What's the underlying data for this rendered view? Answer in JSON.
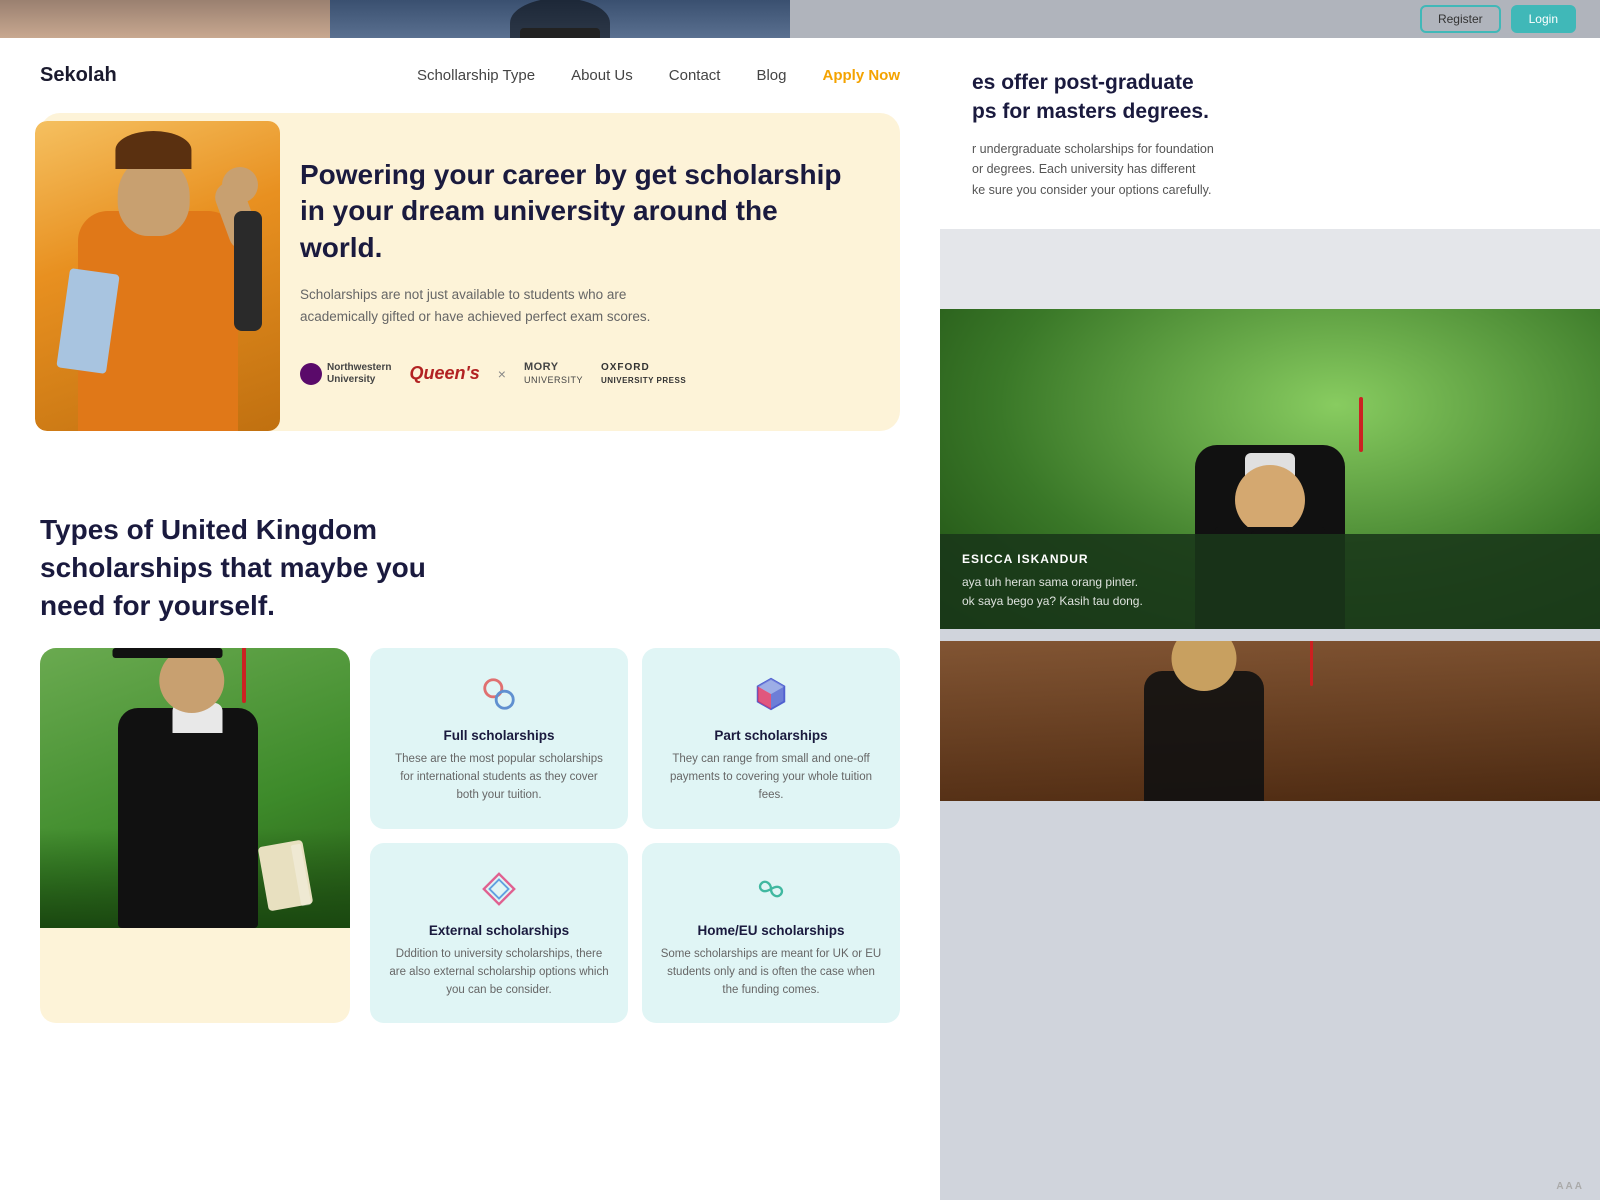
{
  "topBar": {
    "btn1": "Register",
    "btn2": "Login"
  },
  "navbar": {
    "logo": "Sekolah",
    "links": [
      {
        "label": "Schollarship Type",
        "active": false
      },
      {
        "label": "About Us",
        "active": false
      },
      {
        "label": "Contact",
        "active": false
      },
      {
        "label": "Blog",
        "active": false
      },
      {
        "label": "Apply Now",
        "active": true
      }
    ]
  },
  "hero": {
    "title": "Powering your career by get scholarship in your dream university around the world.",
    "subtitle": "Scholarships are not just available to students who are academically gifted or have achieved perfect exam scores.",
    "universities": [
      {
        "name": "Northwestern University",
        "type": "logo-text"
      },
      {
        "name": "Queens",
        "type": "stylized"
      },
      {
        "name": "×",
        "type": "separator"
      },
      {
        "name": "MORY UNIVERSITY",
        "type": "text"
      },
      {
        "name": "OXFORD UNIVERSITY PRESS",
        "type": "text"
      }
    ]
  },
  "section": {
    "heading": "Types of United Kingdom scholarships that maybe you need for yourself."
  },
  "scholarshipCards": [
    {
      "id": "full",
      "title": "Full scholarships",
      "description": "These are the most popular scholarships for international students as they cover both your tuition.",
      "iconType": "circles"
    },
    {
      "id": "part",
      "title": "Part scholarships",
      "description": "They can range from small and one-off payments to covering your whole tuition fees.",
      "iconType": "cube"
    },
    {
      "id": "external",
      "title": "External scholarships",
      "description": "Dddition to university scholarships, there are also external scholarship options which you can be consider.",
      "iconType": "diamond"
    },
    {
      "id": "homeeu",
      "title": "Home/EU scholarships",
      "description": "Some scholarships are meant for UK or EU students only and is often the case when the funding comes.",
      "iconType": "spiral"
    }
  ],
  "rightPanel": {
    "heading1": "es offer post-graduate",
    "heading2": "ps for masters degrees.",
    "body": "r undergraduate scholarships for foundation\nor degrees. Each university has different\nke sure you consider your options carefully.",
    "testimonial": {
      "name": "ESICCA ISKANDUR",
      "text": "aya tuh heran sama orang pinter.\nok saya bego ya? Kasih tau dong."
    }
  }
}
